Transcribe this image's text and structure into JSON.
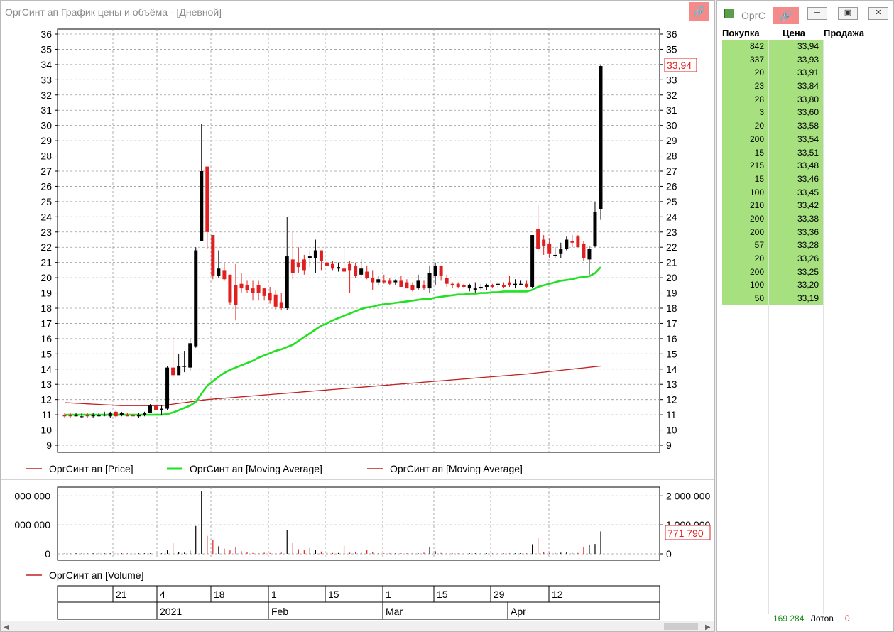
{
  "chart_window": {
    "title": "ОргСинт ап График цены и объёма - [Дневной]",
    "link_icon": "link-icon",
    "price_label": "33,94",
    "volume_label": "771 790"
  },
  "legend": {
    "price": "ОргСинт ап [Price]",
    "ma_fast": "ОргСинт ап [Moving Average]",
    "ma_slow": "ОргСинт ап [Moving Average]",
    "volume": "ОргСинт ап [Volume]"
  },
  "time_axis": {
    "top_labels": [
      "21",
      "4",
      "18",
      "1",
      "15",
      "1",
      "15",
      "29",
      "12"
    ],
    "bottom_labels": [
      "2021",
      "Feb",
      "Mar",
      "Apr"
    ]
  },
  "order_book": {
    "title": "ОргС",
    "headers": {
      "buy": "Покупка",
      "price": "Цена",
      "sell": "Продажа"
    },
    "rows": [
      {
        "qty": "842",
        "price": "33,94"
      },
      {
        "qty": "337",
        "price": "33,93"
      },
      {
        "qty": "20",
        "price": "33,91"
      },
      {
        "qty": "23",
        "price": "33,84"
      },
      {
        "qty": "28",
        "price": "33,80"
      },
      {
        "qty": "3",
        "price": "33,60"
      },
      {
        "qty": "20",
        "price": "33,58"
      },
      {
        "qty": "200",
        "price": "33,54"
      },
      {
        "qty": "15",
        "price": "33,51"
      },
      {
        "qty": "215",
        "price": "33,48"
      },
      {
        "qty": "15",
        "price": "33,46"
      },
      {
        "qty": "100",
        "price": "33,45"
      },
      {
        "qty": "210",
        "price": "33,42"
      },
      {
        "qty": "200",
        "price": "33,38"
      },
      {
        "qty": "200",
        "price": "33,36"
      },
      {
        "qty": "57",
        "price": "33,28"
      },
      {
        "qty": "20",
        "price": "33,26"
      },
      {
        "qty": "200",
        "price": "33,25"
      },
      {
        "qty": "100",
        "price": "33,20"
      },
      {
        "qty": "50",
        "price": "33,19"
      }
    ],
    "footer": {
      "lots": "169 284",
      "lots_label": "Лотов",
      "sell_total": "0"
    },
    "colors": {
      "buy_bg": "#a6e07f",
      "lots": "#1a8a1a",
      "sell": "#d00000"
    }
  },
  "chart_data": [
    {
      "type": "candlestick",
      "ylim": [
        9,
        36
      ],
      "y_ticks": [
        9,
        10,
        11,
        12,
        13,
        14,
        15,
        16,
        17,
        18,
        19,
        20,
        21,
        22,
        23,
        24,
        25,
        26,
        27,
        28,
        29,
        30,
        31,
        32,
        33,
        34,
        35,
        36
      ],
      "grid": true,
      "candles": [
        {
          "o": 11.0,
          "h": 11.1,
          "l": 10.8,
          "c": 10.9
        },
        {
          "o": 11.0,
          "h": 11.1,
          "l": 10.8,
          "c": 10.9
        },
        {
          "o": 10.9,
          "h": 11.1,
          "l": 10.9,
          "c": 11.0
        },
        {
          "o": 10.9,
          "h": 11.1,
          "l": 10.8,
          "c": 10.9
        },
        {
          "o": 11.0,
          "h": 11.1,
          "l": 10.8,
          "c": 10.9
        },
        {
          "o": 10.9,
          "h": 11.1,
          "l": 10.8,
          "c": 11.0
        },
        {
          "o": 10.9,
          "h": 11.1,
          "l": 10.9,
          "c": 11.0
        },
        {
          "o": 11.0,
          "h": 11.2,
          "l": 10.9,
          "c": 11.0
        },
        {
          "o": 10.9,
          "h": 11.2,
          "l": 10.8,
          "c": 11.1
        },
        {
          "o": 11.2,
          "h": 11.3,
          "l": 10.8,
          "c": 10.9
        },
        {
          "o": 11.0,
          "h": 11.2,
          "l": 10.9,
          "c": 11.1
        },
        {
          "o": 11.0,
          "h": 11.1,
          "l": 10.9,
          "c": 10.9
        },
        {
          "o": 11.0,
          "h": 11.1,
          "l": 10.9,
          "c": 10.9
        },
        {
          "o": 10.9,
          "h": 11.1,
          "l": 10.8,
          "c": 11.0
        },
        {
          "o": 11.0,
          "h": 11.2,
          "l": 10.9,
          "c": 11.1
        },
        {
          "o": 11.1,
          "h": 11.7,
          "l": 11.1,
          "c": 11.6
        },
        {
          "o": 11.6,
          "h": 11.9,
          "l": 11.2,
          "c": 11.3
        },
        {
          "o": 11.3,
          "h": 11.6,
          "l": 11.0,
          "c": 11.4
        },
        {
          "o": 11.4,
          "h": 14.2,
          "l": 11.3,
          "c": 14.1
        },
        {
          "o": 14.1,
          "h": 16.1,
          "l": 13.5,
          "c": 13.6
        },
        {
          "o": 13.6,
          "h": 15.0,
          "l": 13.7,
          "c": 14.2
        },
        {
          "o": 14.2,
          "h": 15.2,
          "l": 13.8,
          "c": 14.2
        },
        {
          "o": 14.1,
          "h": 16.0,
          "l": 13.9,
          "c": 15.7
        },
        {
          "o": 15.5,
          "h": 22.0,
          "l": 15.4,
          "c": 21.8
        },
        {
          "o": 22.4,
          "h": 30.1,
          "l": 22.4,
          "c": 27.0
        },
        {
          "o": 27.3,
          "h": 27.3,
          "l": 21.9,
          "c": 23.0
        },
        {
          "o": 22.8,
          "h": 22.8,
          "l": 19.9,
          "c": 20.1
        },
        {
          "o": 20.1,
          "h": 21.8,
          "l": 20.0,
          "c": 20.6
        },
        {
          "o": 20.5,
          "h": 21.0,
          "l": 19.8,
          "c": 19.9
        },
        {
          "o": 20.2,
          "h": 20.2,
          "l": 18.2,
          "c": 18.4
        },
        {
          "o": 19.5,
          "h": 20.9,
          "l": 17.2,
          "c": 18.2
        },
        {
          "o": 19.6,
          "h": 20.3,
          "l": 19.0,
          "c": 19.3
        },
        {
          "o": 19.5,
          "h": 19.8,
          "l": 19.0,
          "c": 19.2
        },
        {
          "o": 19.3,
          "h": 19.8,
          "l": 18.5,
          "c": 19.0
        },
        {
          "o": 19.5,
          "h": 19.8,
          "l": 18.5,
          "c": 19.0
        },
        {
          "o": 19.3,
          "h": 19.3,
          "l": 18.5,
          "c": 18.8
        },
        {
          "o": 19.0,
          "h": 19.4,
          "l": 18.3,
          "c": 18.5
        },
        {
          "o": 18.9,
          "h": 19.2,
          "l": 17.9,
          "c": 18.1
        },
        {
          "o": 18.4,
          "h": 19.0,
          "l": 17.9,
          "c": 18.0
        },
        {
          "o": 18.0,
          "h": 24.0,
          "l": 17.9,
          "c": 21.4
        },
        {
          "o": 21.2,
          "h": 23.0,
          "l": 19.9,
          "c": 20.3
        },
        {
          "o": 21.0,
          "h": 22.0,
          "l": 20.3,
          "c": 20.7
        },
        {
          "o": 21.2,
          "h": 21.5,
          "l": 20.2,
          "c": 20.5
        },
        {
          "o": 21.3,
          "h": 21.8,
          "l": 20.7,
          "c": 21.4
        },
        {
          "o": 21.3,
          "h": 22.5,
          "l": 20.3,
          "c": 21.8
        },
        {
          "o": 21.8,
          "h": 21.8,
          "l": 20.5,
          "c": 21.1
        },
        {
          "o": 21.0,
          "h": 21.2,
          "l": 20.7,
          "c": 20.8
        },
        {
          "o": 20.9,
          "h": 21.1,
          "l": 20.5,
          "c": 20.6
        },
        {
          "o": 20.6,
          "h": 21.0,
          "l": 20.4,
          "c": 20.7
        },
        {
          "o": 20.6,
          "h": 22.0,
          "l": 20.3,
          "c": 20.4
        },
        {
          "o": 20.9,
          "h": 21.1,
          "l": 19.0,
          "c": 20.5
        },
        {
          "o": 20.8,
          "h": 21.0,
          "l": 20.0,
          "c": 20.1
        },
        {
          "o": 20.2,
          "h": 21.2,
          "l": 20.1,
          "c": 20.6
        },
        {
          "o": 20.4,
          "h": 20.8,
          "l": 19.9,
          "c": 20.0
        },
        {
          "o": 20.0,
          "h": 20.5,
          "l": 19.2,
          "c": 19.7
        },
        {
          "o": 19.7,
          "h": 20.1,
          "l": 19.5,
          "c": 19.9
        },
        {
          "o": 19.8,
          "h": 20.2,
          "l": 19.6,
          "c": 19.7
        },
        {
          "o": 19.8,
          "h": 20.0,
          "l": 19.5,
          "c": 19.6
        },
        {
          "o": 19.7,
          "h": 19.9,
          "l": 19.5,
          "c": 19.8
        },
        {
          "o": 19.8,
          "h": 20.1,
          "l": 19.5,
          "c": 19.4
        },
        {
          "o": 19.7,
          "h": 19.9,
          "l": 19.3,
          "c": 19.3
        },
        {
          "o": 19.5,
          "h": 19.7,
          "l": 19.1,
          "c": 19.2
        },
        {
          "o": 19.3,
          "h": 20.2,
          "l": 19.2,
          "c": 19.8
        },
        {
          "o": 19.5,
          "h": 19.8,
          "l": 19.2,
          "c": 19.3
        },
        {
          "o": 19.3,
          "h": 20.8,
          "l": 19.0,
          "c": 20.3
        },
        {
          "o": 20.1,
          "h": 21.0,
          "l": 19.5,
          "c": 20.8
        },
        {
          "o": 20.8,
          "h": 20.8,
          "l": 19.8,
          "c": 20.1
        },
        {
          "o": 20.0,
          "h": 20.2,
          "l": 19.4,
          "c": 19.6
        },
        {
          "o": 19.6,
          "h": 19.7,
          "l": 19.3,
          "c": 19.5
        },
        {
          "o": 19.6,
          "h": 19.7,
          "l": 19.3,
          "c": 19.4
        },
        {
          "o": 19.5,
          "h": 19.6,
          "l": 19.3,
          "c": 19.4
        },
        {
          "o": 19.3,
          "h": 19.6,
          "l": 19.1,
          "c": 19.5
        },
        {
          "o": 19.2,
          "h": 19.7,
          "l": 19.0,
          "c": 19.3
        },
        {
          "o": 19.3,
          "h": 19.6,
          "l": 19.2,
          "c": 19.4
        },
        {
          "o": 19.4,
          "h": 19.6,
          "l": 19.2,
          "c": 19.5
        },
        {
          "o": 19.5,
          "h": 19.6,
          "l": 19.3,
          "c": 19.4
        },
        {
          "o": 19.5,
          "h": 19.7,
          "l": 19.3,
          "c": 19.6
        },
        {
          "o": 19.5,
          "h": 19.7,
          "l": 19.3,
          "c": 19.4
        },
        {
          "o": 19.7,
          "h": 20.1,
          "l": 19.4,
          "c": 19.5
        },
        {
          "o": 19.5,
          "h": 19.9,
          "l": 19.3,
          "c": 19.6
        },
        {
          "o": 19.6,
          "h": 19.8,
          "l": 19.5,
          "c": 19.6
        },
        {
          "o": 19.6,
          "h": 19.8,
          "l": 19.3,
          "c": 19.4
        },
        {
          "o": 19.4,
          "h": 22.8,
          "l": 19.3,
          "c": 22.8
        },
        {
          "o": 23.2,
          "h": 24.8,
          "l": 21.7,
          "c": 21.9
        },
        {
          "o": 22.5,
          "h": 22.8,
          "l": 21.5,
          "c": 22.1
        },
        {
          "o": 22.2,
          "h": 22.6,
          "l": 21.3,
          "c": 21.6
        },
        {
          "o": 21.5,
          "h": 22.0,
          "l": 21.3,
          "c": 21.5
        },
        {
          "o": 21.6,
          "h": 22.3,
          "l": 21.3,
          "c": 21.9
        },
        {
          "o": 21.9,
          "h": 22.7,
          "l": 21.8,
          "c": 22.5
        },
        {
          "o": 22.4,
          "h": 22.8,
          "l": 22.0,
          "c": 22.3
        },
        {
          "o": 22.7,
          "h": 22.8,
          "l": 22.1,
          "c": 22.0
        },
        {
          "o": 22.2,
          "h": 22.4,
          "l": 21.1,
          "c": 21.3
        },
        {
          "o": 21.2,
          "h": 22.1,
          "l": 20.2,
          "c": 21.9
        },
        {
          "o": 22.1,
          "h": 25.0,
          "l": 22.0,
          "c": 24.3
        },
        {
          "o": 24.5,
          "h": 34.0,
          "l": 23.8,
          "c": 33.9
        }
      ],
      "ma_fast": [
        11.0,
        11.0,
        11.0,
        11.0,
        11.0,
        11.0,
        11.0,
        11.0,
        11.0,
        11.0,
        11.0,
        11.0,
        11.0,
        11.0,
        11.0,
        11.0,
        11.0,
        11.0,
        11.05,
        11.15,
        11.3,
        11.45,
        11.6,
        11.85,
        12.4,
        12.9,
        13.2,
        13.5,
        13.75,
        13.95,
        14.1,
        14.25,
        14.4,
        14.55,
        14.75,
        14.9,
        15.05,
        15.2,
        15.3,
        15.45,
        15.6,
        15.85,
        16.1,
        16.35,
        16.6,
        16.85,
        17.0,
        17.2,
        17.35,
        17.5,
        17.65,
        17.8,
        17.95,
        18.05,
        18.1,
        18.2,
        18.25,
        18.3,
        18.35,
        18.4,
        18.45,
        18.5,
        18.55,
        18.6,
        18.6,
        18.7,
        18.75,
        18.8,
        18.85,
        18.9,
        18.9,
        18.95,
        18.95,
        19.0,
        19.0,
        19.05,
        19.05,
        19.1,
        19.1,
        19.1,
        19.1,
        19.1,
        19.2,
        19.4,
        19.5,
        19.6,
        19.7,
        19.8,
        19.85,
        19.9,
        20.0,
        20.05,
        20.1,
        20.3,
        20.7
      ],
      "ma_slow": [
        11.8,
        11.78,
        11.76,
        11.74,
        11.72,
        11.7,
        11.68,
        11.66,
        11.64,
        11.62,
        11.6,
        11.6,
        11.6,
        11.6,
        11.6,
        11.6,
        11.6,
        11.6,
        11.65,
        11.7,
        11.75,
        11.8,
        11.85,
        11.9,
        11.95,
        12.0,
        12.03,
        12.06,
        12.09,
        12.12,
        12.15,
        12.18,
        12.21,
        12.24,
        12.27,
        12.3,
        12.33,
        12.36,
        12.39,
        12.42,
        12.45,
        12.48,
        12.51,
        12.54,
        12.57,
        12.6,
        12.63,
        12.66,
        12.69,
        12.72,
        12.75,
        12.78,
        12.81,
        12.84,
        12.87,
        12.9,
        12.93,
        12.96,
        12.99,
        13.02,
        13.05,
        13.08,
        13.11,
        13.14,
        13.17,
        13.2,
        13.23,
        13.26,
        13.29,
        13.32,
        13.35,
        13.38,
        13.41,
        13.44,
        13.47,
        13.5,
        13.53,
        13.56,
        13.59,
        13.62,
        13.65,
        13.68,
        13.72,
        13.76,
        13.8,
        13.84,
        13.88,
        13.92,
        13.96,
        14.0,
        14.04,
        14.08,
        14.12,
        14.16,
        14.2
      ],
      "colors": {
        "up": "#000000",
        "down": "#e02020",
        "ma_fast": "#22e022",
        "ma_slow": "#c02020"
      }
    },
    {
      "type": "bar",
      "ylim": [
        0,
        2300000
      ],
      "y_ticks": [
        0,
        1000000,
        2000000
      ],
      "y_tick_labels": [
        "0",
        "000 000",
        "000 000"
      ],
      "y_tick_labels_right": [
        "0",
        "1 000 000",
        "2 000 000"
      ],
      "values": [
        3000,
        3000,
        5000,
        3000,
        4000,
        3000,
        5000,
        4000,
        6000,
        4000,
        5000,
        4000,
        4000,
        6000,
        5000,
        15000,
        20000,
        15000,
        120000,
        380000,
        60000,
        40000,
        110000,
        960000,
        2160000,
        620000,
        480000,
        260000,
        180000,
        120000,
        240000,
        90000,
        60000,
        30000,
        20000,
        40000,
        30000,
        20000,
        40000,
        820000,
        380000,
        160000,
        120000,
        200000,
        140000,
        80000,
        50000,
        30000,
        30000,
        270000,
        40000,
        50000,
        40000,
        130000,
        50000,
        20000,
        20000,
        20000,
        20000,
        20000,
        20000,
        15000,
        20000,
        40000,
        220000,
        90000,
        30000,
        20000,
        20000,
        15000,
        15000,
        20000,
        15000,
        15000,
        15000,
        15000,
        15000,
        15000,
        20000,
        15000,
        15000,
        20000,
        330000,
        560000,
        60000,
        30000,
        30000,
        40000,
        60000,
        30000,
        30000,
        220000,
        320000,
        340000,
        771790
      ],
      "colors": {
        "up": "#000000",
        "down": "#e02020"
      }
    }
  ]
}
